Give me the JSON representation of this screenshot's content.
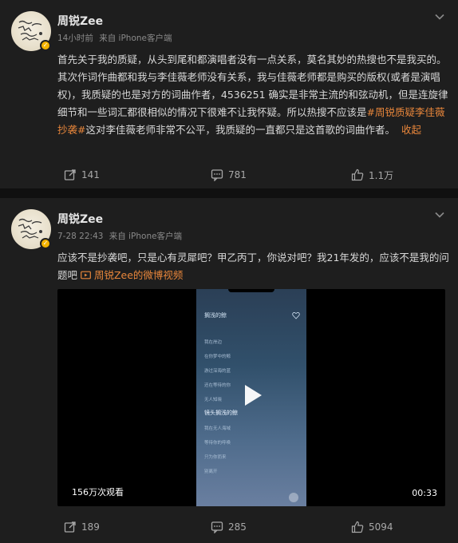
{
  "posts": [
    {
      "author": "周锐Zee",
      "time": "14小时前",
      "source": "来自 iPhone客户端",
      "text": {
        "body1": "首先关于我的质疑，从头到尾和都演唱者没有一点关系，莫名其妙的热搜也不是我买的。其次作词作曲都和我与李佳薇老师没有关系，我与佳薇老师都是购买的版权(或者是演唱权)，我质疑的也是对方的词曲作者，4536251 确实是非常主流的和弦动机，但是连旋律细节和一些词汇都很相似的情况下很难不让我怀疑。所以热搜不应该是",
        "hashtag": "#周锐质疑李佳薇抄袭#",
        "body2": "这对李佳薇老师非常不公平，我质疑的一直都只是这首歌的词曲作者。",
        "collapse": "收起"
      },
      "actions": {
        "repost": "141",
        "comment": "781",
        "like": "1.1万"
      }
    },
    {
      "author": "周锐Zee",
      "time": "7-28 22:43",
      "source": "来自 iPhone客户端",
      "text": {
        "body": "应该不是抄袭吧，只是心有灵犀吧？甲乙丙丁，你说对吧？我21年发的，应该不是我的问题吧",
        "link": "周锐Zee的微博视频"
      },
      "video": {
        "views": "156万次观看",
        "duration": "00:33",
        "song_title": "搁浅的鲸",
        "lyrics": [
          "我在岸边",
          "在你梦中的鲸",
          "游过深海的蓝",
          "还在等待的你",
          "无人知晓",
          "镜头搁浅的鲸",
          "我在无人海域",
          "等待你的呼唤",
          "只为你而来",
          "别离开"
        ]
      },
      "actions": {
        "repost": "189",
        "comment": "285",
        "like": "5094"
      }
    }
  ],
  "icons": {
    "repost": "repost-icon",
    "comment": "comment-icon",
    "like": "like-icon",
    "more": "chevron-down-icon",
    "verified": "verified-badge-icon"
  },
  "colors": {
    "accent": "#e8863b",
    "verified": "#f5b400",
    "background": "#1e1e1e"
  }
}
